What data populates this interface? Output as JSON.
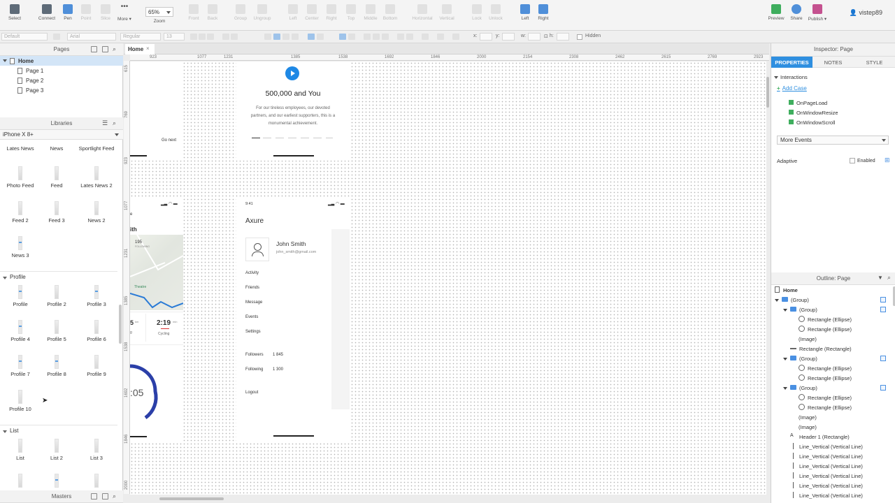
{
  "toolbar": {
    "buttons": [
      {
        "label": "Select",
        "icon": "pointer-icon"
      },
      {
        "label": "Connect",
        "icon": "connect-icon"
      },
      {
        "label": "Pen",
        "icon": "pen-icon"
      },
      {
        "label": "Point",
        "icon": "point-icon"
      },
      {
        "label": "Slice",
        "icon": "slice-icon"
      },
      {
        "label": "More ▾",
        "icon": "more-icon"
      }
    ],
    "zoom_value": "65%",
    "zoom_label": "Zoom",
    "arrange": [
      "Front",
      "Back",
      "Group",
      "Ungroup",
      "Left",
      "Center",
      "Right",
      "Top",
      "Middle",
      "Bottom",
      "Horizontal",
      "Vertical",
      "Lock",
      "Unlock"
    ],
    "right_buttons": [
      "Left",
      "Right"
    ],
    "publish": [
      "Preview",
      "Share",
      "Publish ▾"
    ],
    "user": "vistep89"
  },
  "formatbar": {
    "style": "Default",
    "font": "Arial",
    "weight": "Regular",
    "size": "13",
    "x_label": "x:",
    "y_label": "y:",
    "w_label": "w:",
    "h_label": "h:",
    "hidden_label": "Hidden"
  },
  "pages": {
    "title": "Pages",
    "items": [
      "Home",
      "Page 1",
      "Page 2",
      "Page 3"
    ]
  },
  "libraries": {
    "title": "Libraries",
    "selected": "iPhone X 8+",
    "news": [
      "Lates News",
      "News",
      "Sportlight Feed",
      "Photo Feed",
      "Feed",
      "Lates News 2",
      "Feed 2",
      "Feed 3",
      "News 2",
      "News 3"
    ],
    "profile_section": "Profile",
    "profile": [
      "Profile",
      "Profile 2",
      "Profile 3",
      "Profile 4",
      "Profile 5",
      "Profile 6",
      "Profile 7",
      "Profile 8",
      "Profile 9",
      "Profile 10"
    ],
    "list_section": "List",
    "list": [
      "List",
      "List 2",
      "List 3"
    ]
  },
  "masters": {
    "title": "Masters"
  },
  "canvas": {
    "tab": "Home",
    "ruler_h": [
      "923",
      "1077",
      "1231",
      "1385",
      "1538",
      "1692",
      "1846",
      "2000",
      "2154",
      "2308",
      "2462",
      "2615",
      "2769",
      "2923"
    ],
    "ruler_v": [
      "615",
      "769",
      "923",
      "1077",
      "1231",
      "1385",
      "1538",
      "1692",
      "1846",
      "2000"
    ],
    "screen1": {
      "heading": "500,000 and You",
      "body": "For our tireless employees, our devoted partners, and our earliest supporters, this is a monumental achievement.",
      "left_link": "Go next"
    },
    "screen2": {
      "time": "9:41",
      "brand": "Axure",
      "name": "John Smith",
      "email": "john_smith@gmail.com",
      "menu": [
        "Activity",
        "Friends",
        "Message",
        "Events",
        "Settings"
      ],
      "followers_label": "Followers",
      "followers_value": "1 845",
      "following_label": "Following",
      "following_value": "1 300",
      "logout": "Logout"
    },
    "screen_left": {
      "title_fragment": "ith",
      "stat_number": "195",
      "stat_caption": "FOLLOWING",
      "map_label": "Theatre",
      "stat_a": "5",
      "stat_a_unit": "km",
      "time_value": "2:19",
      "time_unit": "min",
      "time_caption": "Cycling",
      "stat_a_caption": "g",
      "ring_value": ":05"
    }
  },
  "inspector": {
    "title": "Inspector: Page",
    "tabs": [
      "PROPERTIES",
      "NOTES",
      "STYLE"
    ],
    "interactions_label": "Interactions",
    "add_case": "Add Case",
    "events": [
      "OnPageLoad",
      "OnWindowResize",
      "OnWindowScroll"
    ],
    "more_events": "More Events",
    "adaptive_label": "Adaptive",
    "enabled_label": "Enabled"
  },
  "outline": {
    "title": "Outline: Page",
    "root": "Home",
    "rows": [
      {
        "label": "(Group)",
        "type": "folder",
        "indent": 0,
        "expand": true,
        "check": true
      },
      {
        "label": "(Group)",
        "type": "folder",
        "indent": 1,
        "expand": true,
        "check": true
      },
      {
        "label": "Rectangle (Ellipse)",
        "type": "circle",
        "indent": 2
      },
      {
        "label": "Rectangle (Ellipse)",
        "type": "circle",
        "indent": 2
      },
      {
        "label": "(Image)",
        "type": "none",
        "indent": 2
      },
      {
        "label": "Rectangle (Rectangle)",
        "type": "line",
        "indent": 1
      },
      {
        "label": "(Group)",
        "type": "folder",
        "indent": 1,
        "expand": true,
        "check": true
      },
      {
        "label": "Rectangle (Ellipse)",
        "type": "circle",
        "indent": 2
      },
      {
        "label": "Rectangle (Ellipse)",
        "type": "circle",
        "indent": 2
      },
      {
        "label": "(Group)",
        "type": "folder",
        "indent": 1,
        "expand": true,
        "check": true
      },
      {
        "label": "Rectangle (Ellipse)",
        "type": "circle",
        "indent": 2
      },
      {
        "label": "Rectangle (Ellipse)",
        "type": "circle",
        "indent": 2
      },
      {
        "label": "(Image)",
        "type": "none",
        "indent": 2
      },
      {
        "label": "(Image)",
        "type": "none",
        "indent": 2
      },
      {
        "label": "Header 1 (Rectangle)",
        "type": "text",
        "indent": 1
      },
      {
        "label": "Line_Vertical (Vertical Line)",
        "type": "vline",
        "indent": 1
      },
      {
        "label": "Line_Vertical (Vertical Line)",
        "type": "vline",
        "indent": 1
      },
      {
        "label": "Line_Vertical (Vertical Line)",
        "type": "vline",
        "indent": 1
      },
      {
        "label": "Line_Vertical (Vertical Line)",
        "type": "vline",
        "indent": 1
      },
      {
        "label": "Line_Vertical (Vertical Line)",
        "type": "vline",
        "indent": 1
      },
      {
        "label": "Line_Vertical (Vertical Line)",
        "type": "vline",
        "indent": 1
      }
    ]
  },
  "colors": {
    "accent": "#2f8fe0",
    "selection": "#d3e5f7",
    "event_flag": "#3fae5e",
    "play": "#1e88e5",
    "ring": "#2b3fa8"
  }
}
